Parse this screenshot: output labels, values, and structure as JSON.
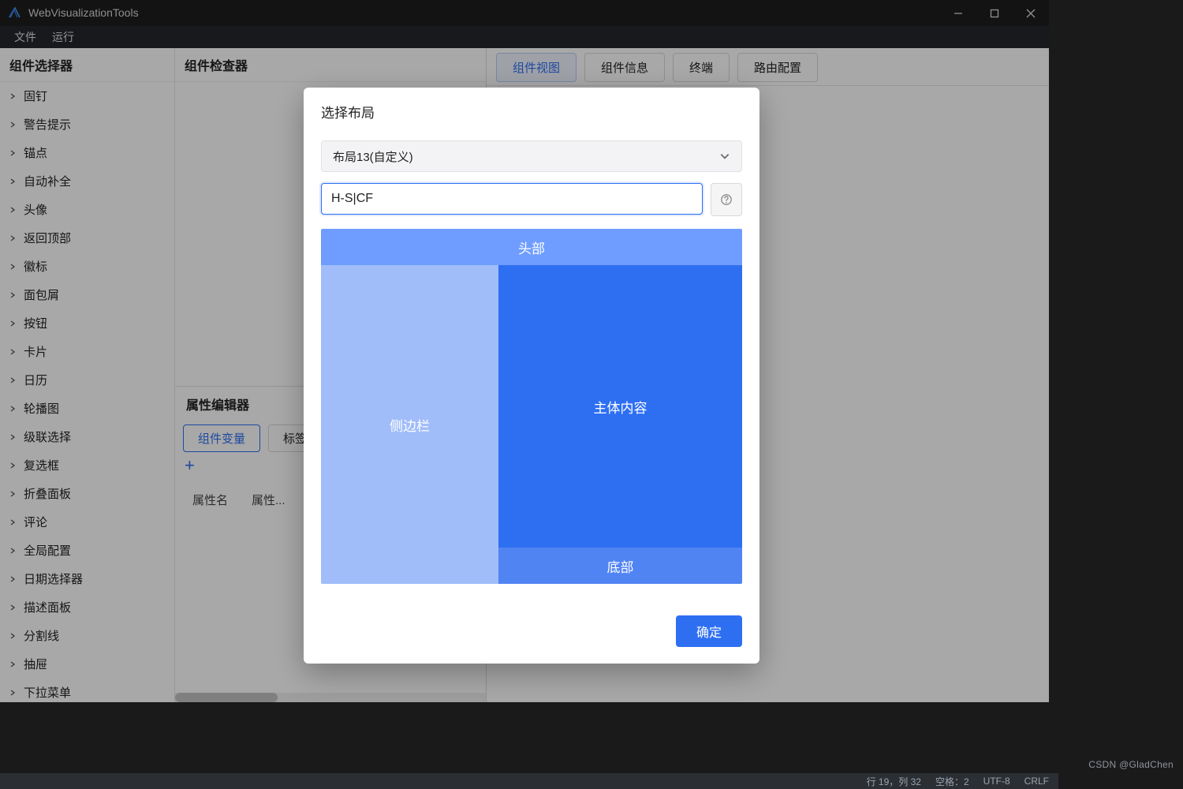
{
  "window": {
    "app_title": "WebVisualizationTools"
  },
  "menu": {
    "items": [
      "文件",
      "运行"
    ]
  },
  "sidebar_panel": {
    "title": "组件选择器",
    "items": [
      "固钉",
      "警告提示",
      "锚点",
      "自动补全",
      "头像",
      "返回顶部",
      "徽标",
      "面包屑",
      "按钮",
      "卡片",
      "日历",
      "轮播图",
      "级联选择",
      "复选框",
      "折叠面板",
      "评论",
      "全局配置",
      "日期选择器",
      "描述面板",
      "分割线",
      "抽屉",
      "下拉菜单"
    ]
  },
  "inspector": {
    "title": "组件检查器",
    "prop_editor": {
      "title": "属性编辑器",
      "tabs": {
        "vars": "组件变量",
        "labels": "标签属"
      },
      "add_label": "+",
      "columns": {
        "name": "属性名",
        "value": "属性..."
      }
    }
  },
  "right_tabs": {
    "items": [
      "组件视图",
      "组件信息",
      "终端",
      "路由配置"
    ],
    "activeIndex": 0
  },
  "modal": {
    "title": "选择布局",
    "select_value": "布局13(自定义)",
    "input_value": "H-S|CF",
    "help_symbol": "?",
    "preview": {
      "header": "头部",
      "sidebar": "侧边栏",
      "content": "主体内容",
      "footer": "底部"
    },
    "ok_label": "确定"
  },
  "statusbar": {
    "pos": "行 19，列 32",
    "spaces": "空格：2",
    "encoding": "UTF-8",
    "eol": "CRLF"
  },
  "watermark": "CSDN @GladChen"
}
